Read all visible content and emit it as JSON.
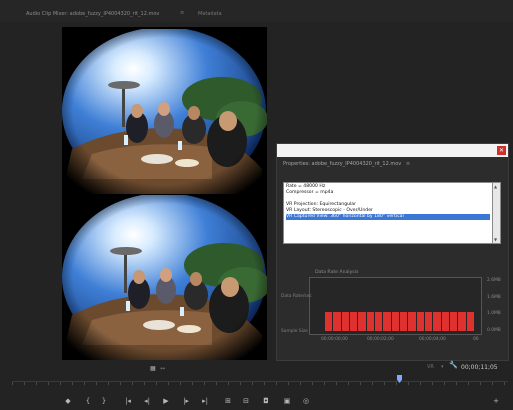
{
  "panel": {
    "title": "Audio Clip Mixer: adobe_fuzzy_IP4004320_rit_12.mov",
    "separator": "≡",
    "metadata_label": "Metadata"
  },
  "properties": {
    "title": "Properties: adobe_fuzzy_IP4004320_rit_12.mov",
    "menu_icon": "menu-icon",
    "lines": [
      "Rate = 48000 Hz",
      "Compressor = mp4a",
      "",
      "VR Projection: Equirectangular",
      "VR Layout: Stereoscopic - Over/Under",
      "VR Captured View: 360° horizontal by 180° vertical"
    ],
    "selected_line_index": 5,
    "data_rate": {
      "title": "Data Rate Analysis",
      "y_axis_top": "Data Rate/sec",
      "y_axis_bottom": "Sample Size",
      "right_ticks": [
        "2.6MB",
        "1.6MB",
        "1.0MB",
        "0.0MB"
      ],
      "time_ticks": [
        "00;00;00;00",
        "00;00;02;00",
        "00;00;04;00",
        "00"
      ],
      "bar_count": 18,
      "bar_color": "#e03131"
    }
  },
  "viewer": {
    "view_icon": "▦",
    "expand_icon": "↔",
    "vr_label": "VR",
    "vr_dropdown": "▾",
    "timecode": "00;00;11;05"
  },
  "transport": {
    "buttons": [
      {
        "name": "add-marker-button",
        "glyph": "◆",
        "icon": "marker-icon"
      },
      {
        "name": "mark-in-button",
        "glyph": "{",
        "icon": "mark-in-icon"
      },
      {
        "name": "mark-out-button",
        "glyph": "}",
        "icon": "mark-out-icon"
      },
      {
        "name": "go-to-in-button",
        "glyph": "|◂",
        "icon": "go-to-in-icon"
      },
      {
        "name": "step-back-button",
        "glyph": "◂|",
        "icon": "step-back-icon"
      },
      {
        "name": "play-button",
        "glyph": "▶",
        "icon": "play-icon"
      },
      {
        "name": "step-forward-button",
        "glyph": "|▸",
        "icon": "step-forward-icon"
      },
      {
        "name": "go-to-out-button",
        "glyph": "▸|",
        "icon": "go-to-out-icon"
      },
      {
        "name": "insert-button",
        "glyph": "⊞",
        "icon": "insert-icon"
      },
      {
        "name": "overwrite-button",
        "glyph": "⊟",
        "icon": "overwrite-icon"
      },
      {
        "name": "export-frame-button",
        "glyph": "◘",
        "icon": "camera-icon"
      },
      {
        "name": "vr-toggle-button",
        "glyph": "▣",
        "icon": "vr-video-icon"
      },
      {
        "name": "settings-button",
        "glyph": "◎",
        "icon": "settings-icon"
      },
      {
        "name": "add-button",
        "glyph": "+",
        "icon": "plus-icon"
      }
    ]
  },
  "colors": {
    "background": "#232323",
    "accent": "#3b78d6",
    "close": "#d0302a",
    "playhead": "#7fa9ff"
  }
}
